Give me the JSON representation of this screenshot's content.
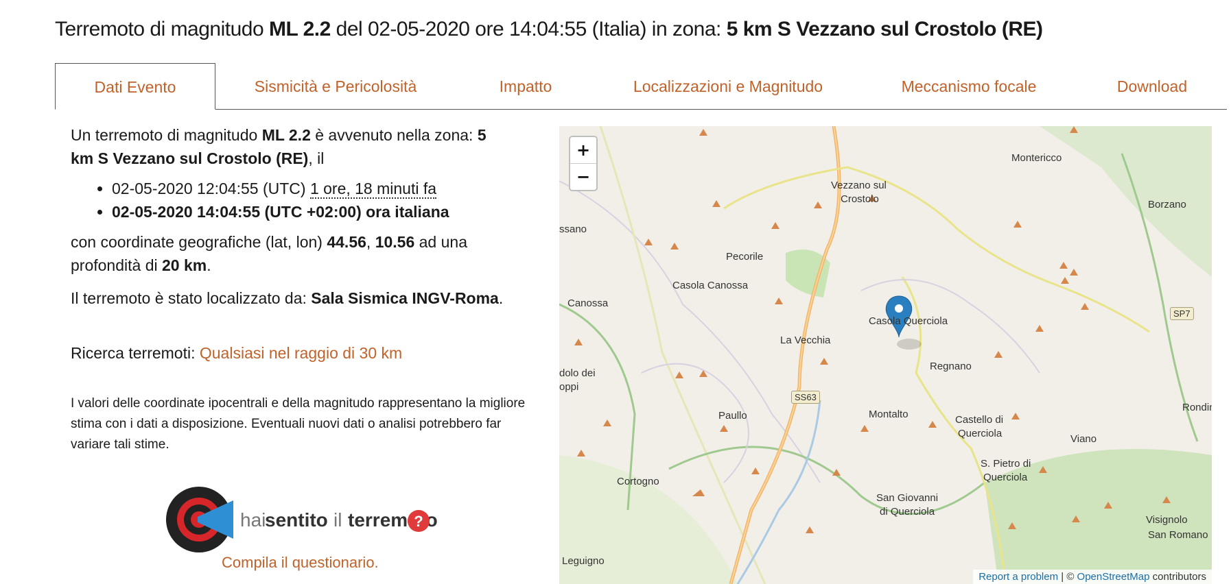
{
  "title": {
    "prefix": "Terremoto di magnitudo ",
    "magnitude": "ML 2.2",
    "mid": " del 02-05-2020 ore 14:04:55 (Italia) in zona: ",
    "zone": "5 km S Vezzano sul Crostolo (RE)"
  },
  "tabs": [
    {
      "label": "Dati Evento",
      "active": true
    },
    {
      "label": "Sismicità e Pericolosità"
    },
    {
      "label": "Impatto"
    },
    {
      "label": "Localizzazioni e Magnitudo"
    },
    {
      "label": "Meccanismo focale"
    },
    {
      "label": "Download"
    }
  ],
  "event": {
    "intro": "Un terremoto di magnitudo ",
    "magnitude": "ML 2.2",
    "intro_mid": " è avvenuto nella zona: ",
    "zone": "5 km S Vezzano sul Crostolo (RE)",
    "intro_end": ", il",
    "utc_time": "02-05-2020 12:04:55 (UTC) ",
    "ago": "1 ore, 18 minuti fa",
    "local_time": "02-05-2020 14:04:55 (UTC +02:00) ora italiana",
    "coords_intro": "con coordinate geografiche (lat, lon) ",
    "lat": "44.56",
    "sep": ", ",
    "lon": "10.56",
    "depth_intro": " ad una profondità di ",
    "depth": "20 km",
    "depth_end": ".",
    "located_intro": "Il terremoto è stato localizzato da: ",
    "located_by": "Sala Sismica INGV-Roma",
    "located_end": ".",
    "search_label": "Ricerca terremoti: ",
    "search_link": "Qualsiasi nel raggio di 30 km",
    "disclaimer": "I valori delle coordinate ipocentrali e della magnitudo rappresentano la migliore stima con i dati a disposizione. Eventuali nuovi dati o analisi potrebbero far variare tali stime."
  },
  "hst_logo": {
    "hai": "hai",
    "sentito": "sentito",
    "il": "il",
    "terremoto": "terremoto",
    "q": "?"
  },
  "compila": "Compila il questionario.",
  "map": {
    "zoom_in": "+",
    "zoom_out": "−",
    "attribution_report": "Report a problem",
    "attribution_sep": " | © ",
    "attribution_osm": "OpenStreetMap",
    "attribution_end": " contributors",
    "labels": [
      "Montericco",
      "Vezzano sul",
      "Crostolo",
      "Borzano",
      "ssano",
      "Pecorile",
      "Casola Canossa",
      "Canossa",
      "Casola Querciola",
      "SP7",
      "La Vecchia",
      "Regnano",
      "dolo dei",
      "oppi",
      "SS63",
      "Paullo",
      "Montalto",
      "Castello di",
      "Querciola",
      "Rondin",
      "Viano",
      "S. Pietro di",
      "Querciola",
      "Cortogno",
      "San Giovanni",
      "di Querciola",
      "Visignolo",
      "San Romano",
      "Leguigno"
    ]
  },
  "colors": {
    "accent": "#c0622a",
    "marker": "#2a7fc0",
    "link_blue": "#1a6fa8"
  }
}
